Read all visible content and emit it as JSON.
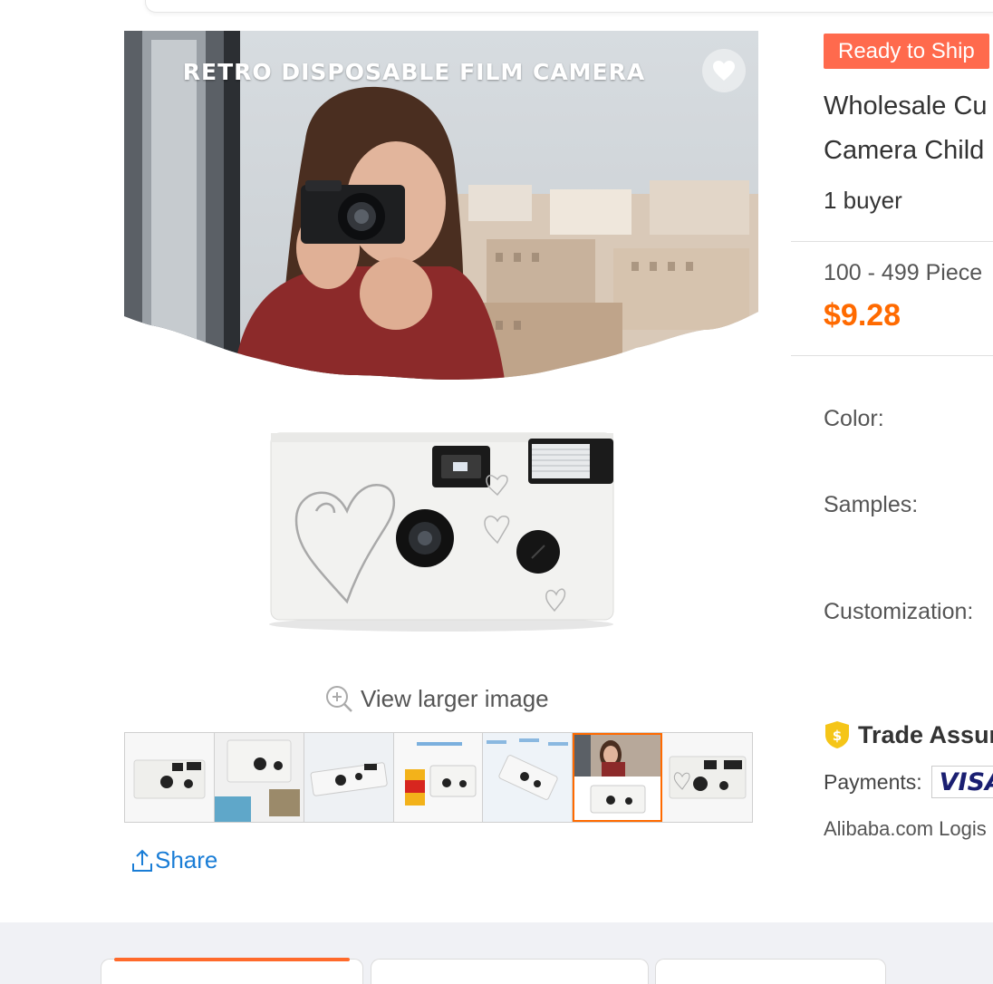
{
  "gallery": {
    "main_image_caption": "RETRO DISPOSABLE FILM CAMERA",
    "view_larger_label": "View larger image",
    "thumbnail_count": 7,
    "active_thumbnail": 6,
    "share_label": "Share"
  },
  "product": {
    "badge": "Ready to Ship",
    "title_line1": "Wholesale Cu",
    "title_line2": "Camera Child",
    "buyers": "1 buyer",
    "quantity_range": "100 - 499 Piece",
    "price": "$9.28",
    "price_color": "#ff6a00"
  },
  "attributes": {
    "color_label": "Color:",
    "samples_label": "Samples:",
    "customization_label": "Customization:"
  },
  "assurance": {
    "trade_label": "Trade Assur",
    "payments_label": "Payments:",
    "visa_text": "VISA",
    "logistics_text": "Alibaba.com Logis"
  },
  "colors": {
    "accent": "#ff6a00",
    "badge": "#ff6a4d",
    "link": "#1a7dd6"
  }
}
